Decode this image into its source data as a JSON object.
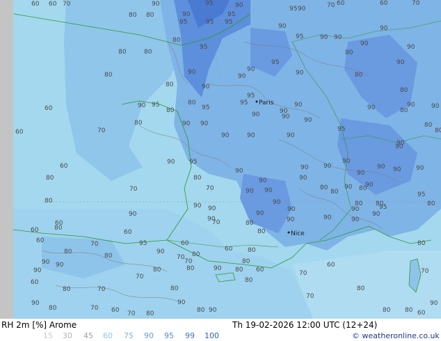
{
  "map": {
    "iso_labels": [
      "60",
      "60",
      "70",
      "95",
      "90",
      "70",
      "60",
      "60",
      "70",
      "80",
      "80",
      "90",
      "95",
      "90",
      "95",
      "95",
      "95",
      "90",
      "95",
      "80",
      "90",
      "80",
      "80",
      "90",
      "95",
      "80",
      "95",
      "90",
      "90",
      "80",
      "90",
      "80",
      "90",
      "90",
      "80",
      "90",
      "90",
      "90",
      "80",
      "95",
      "90",
      "90",
      "90",
      "90",
      "80",
      "80",
      "80",
      "70",
      "90",
      "90",
      "95",
      "90",
      "90",
      "90",
      "95",
      "80",
      "80",
      "90",
      "95",
      "90",
      "95",
      "60",
      "80",
      "95",
      "90",
      "90",
      "90",
      "90",
      "90",
      "90",
      "60",
      "60",
      "70",
      "90",
      "90",
      "90",
      "90",
      "90",
      "90",
      "90",
      "90",
      "90",
      "80",
      "90",
      "80",
      "90",
      "90",
      "90",
      "90",
      "90",
      "80",
      "90",
      "90",
      "90",
      "95",
      "80",
      "95",
      "90",
      "80",
      "90",
      "90",
      "80",
      "90",
      "60",
      "70",
      "90",
      "80",
      "90",
      "90",
      "95",
      "80",
      "90",
      "80",
      "80",
      "80",
      "90",
      "90",
      "70",
      "80",
      "60",
      "70",
      "80",
      "60",
      "80",
      "80",
      "70",
      "90",
      "60",
      "60",
      "60",
      "70",
      "80",
      "80",
      "90",
      "90",
      "80",
      "95",
      "80",
      "90",
      "90",
      "80",
      "60",
      "80",
      "70",
      "60",
      "70",
      "80",
      "80",
      "70",
      "90",
      "60",
      "80",
      "70",
      "70",
      "80",
      "90",
      "90",
      "60",
      "70",
      "80",
      "80",
      "70",
      "80",
      "90",
      "80",
      "80",
      "60",
      "70",
      "60",
      "60",
      "60",
      "70",
      "70",
      "60",
      "60",
      "60"
    ],
    "cities": [
      "Paris",
      "Nice"
    ]
  },
  "footer": {
    "title": "RH 2m [%] Arome",
    "valid": "Th 19-02-2026 12:00 UTC (12+24)",
    "credit": "© weatheronline.co.uk",
    "scale": [
      {
        "label": "15",
        "color": "#c8c8c8"
      },
      {
        "label": "30",
        "color": "#b4b4b4"
      },
      {
        "label": "45",
        "color": "#a0a0a0"
      },
      {
        "label": "60",
        "color": "#8cc8f0"
      },
      {
        "label": "75",
        "color": "#78b4e6"
      },
      {
        "label": "90",
        "color": "#64a0dc"
      },
      {
        "label": "95",
        "color": "#508cd2"
      },
      {
        "label": "99",
        "color": "#3c78c8"
      },
      {
        "label": "100",
        "color": "#2864be"
      }
    ]
  }
}
